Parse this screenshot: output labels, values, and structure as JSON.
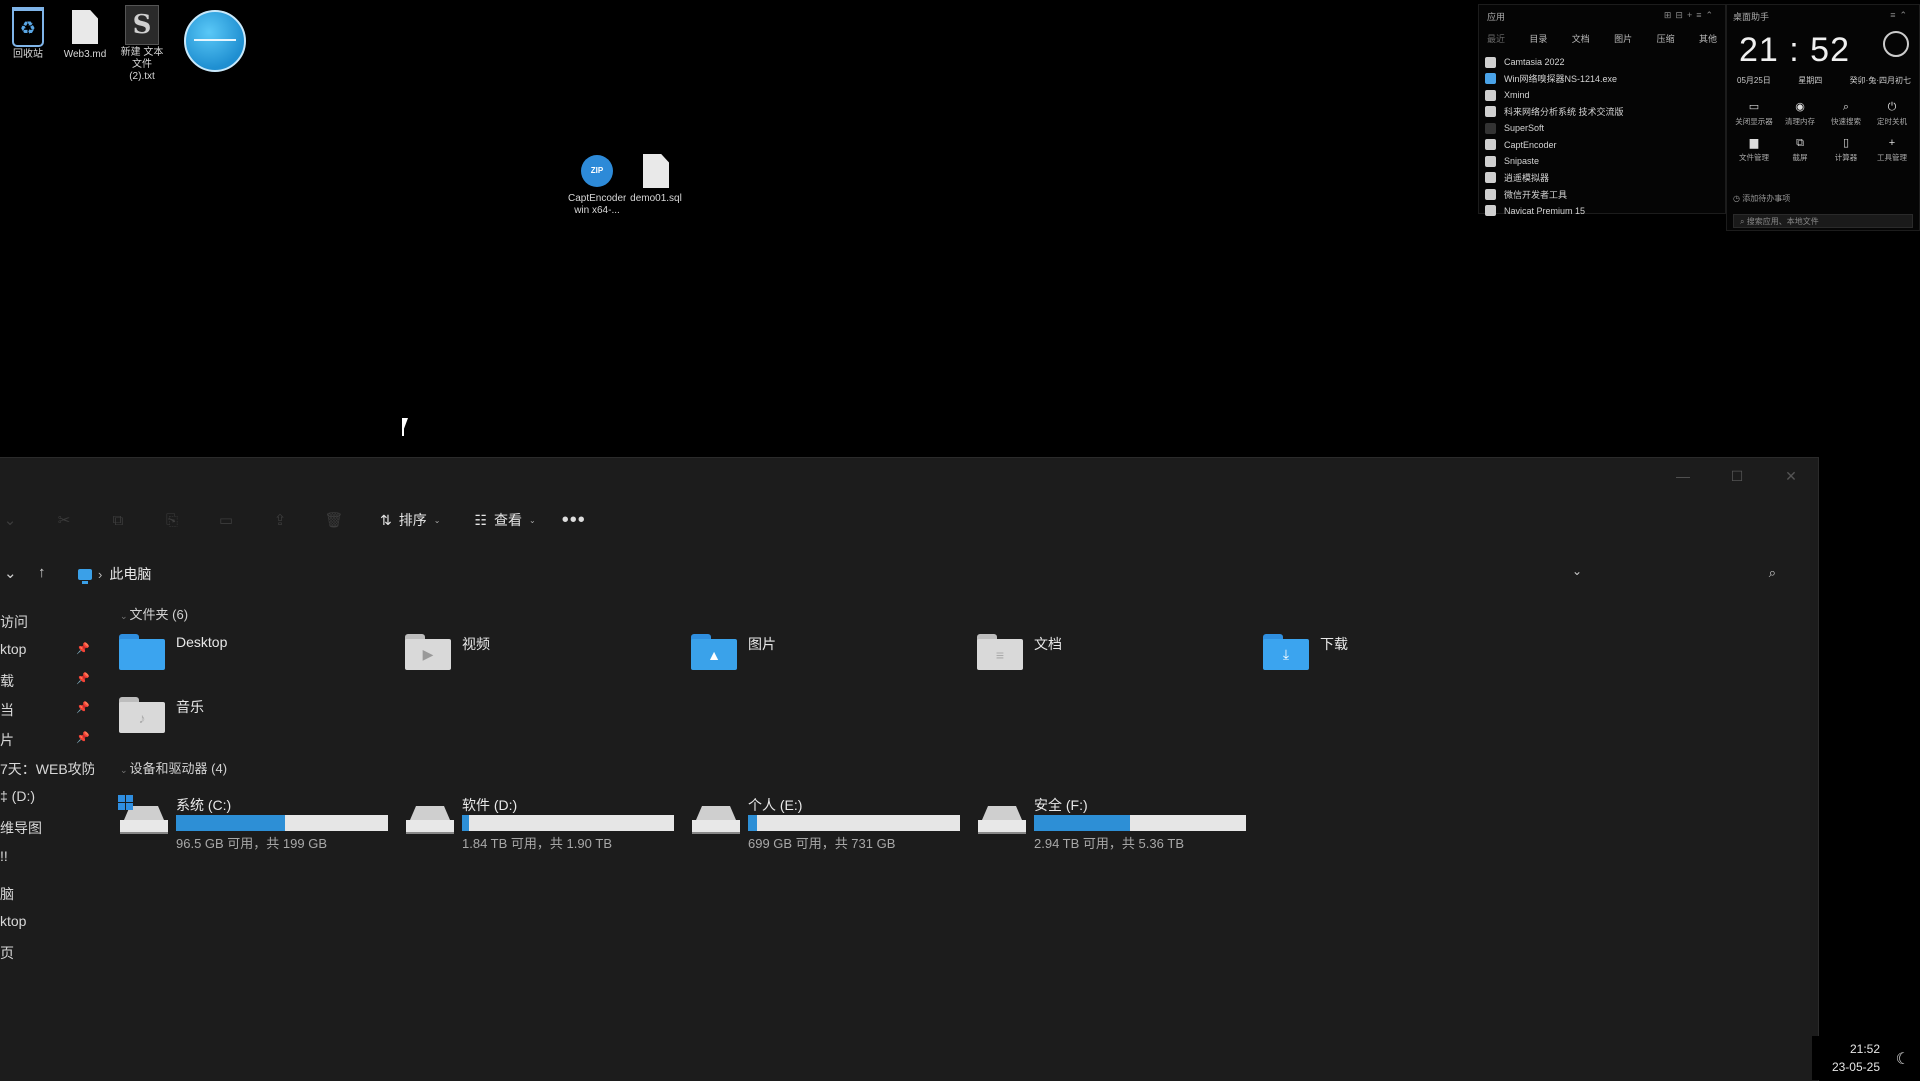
{
  "desktop": {
    "icons": [
      {
        "label": "回收站"
      },
      {
        "label": "Web3.md"
      },
      {
        "label": "新建 文本文件 (2).txt"
      }
    ],
    "middle_icons": [
      {
        "label": "CaptEncoder-win x64-..."
      },
      {
        "label": "demo01.sql"
      }
    ]
  },
  "apps_widget": {
    "title": "应用",
    "tabs": [
      "最近",
      "目录",
      "文档",
      "图片",
      "压缩",
      "其他"
    ],
    "apps": [
      "Camtasia 2022",
      "Win网络嗅探器NS-1214.exe",
      "Xmind",
      "科来网络分析系统 技术交流版",
      "SuperSoft",
      "CaptEncoder",
      "Snipaste",
      "逍遥模拟器",
      "微信开发者工具",
      "Navicat Premium 15"
    ]
  },
  "clock_widget": {
    "title": "桌面助手",
    "time": "21 : 52",
    "date": "05月25日",
    "weekday": "星期四",
    "lunar": "癸卯·兔·四月初七",
    "tools": [
      "关闭显示器",
      "清理内存",
      "快速搜索",
      "定时关机",
      "文件管理",
      "截屏",
      "计算器",
      "工具管理"
    ],
    "note": "添加待办事项",
    "search_placeholder": "搜索应用、本地文件"
  },
  "toolbar": {
    "sort": "排序",
    "view": "查看",
    "more": "•••"
  },
  "address": {
    "path": "此电脑"
  },
  "sidebar": {
    "items": [
      {
        "label": "访问"
      },
      {
        "label": "ktop"
      },
      {
        "label": "载"
      },
      {
        "label": "当"
      },
      {
        "label": "片"
      },
      {
        "label": "7天：WEB攻防"
      },
      {
        "label": "‡ (D:)"
      },
      {
        "label": "维导图"
      },
      {
        "label": "!!"
      },
      {
        "label": "脑"
      },
      {
        "label": "ktop"
      },
      {
        "label": "页"
      }
    ]
  },
  "content": {
    "folders_header": "文件夹 (6)",
    "folders": [
      {
        "label": "Desktop",
        "color": "#2f8fe0"
      },
      {
        "label": "视频",
        "color": "#d9d9d9"
      },
      {
        "label": "图片",
        "color": "#3aa2ea"
      },
      {
        "label": "文档",
        "color": "#d9d9d9"
      },
      {
        "label": "下载",
        "color": "#2f8fe0"
      },
      {
        "label": "音乐",
        "color": "#d9d9d9"
      }
    ],
    "drives_header": "设备和驱动器 (4)",
    "drives": [
      {
        "name": "系统 (C:)",
        "free": "96.5 GB 可用，共 199 GB",
        "used_fraction": 0.515
      },
      {
        "name": "软件 (D:)",
        "free": "1.84 TB 可用，共 1.90 TB",
        "used_fraction": 0.032
      },
      {
        "name": "个人 (E:)",
        "free": "699 GB 可用，共 731 GB",
        "used_fraction": 0.044
      },
      {
        "name": "安全 (F:)",
        "free": "2.94 TB 可用，共 5.36 TB",
        "used_fraction": 0.452
      }
    ]
  },
  "taskbar": {
    "time": "21:52",
    "date": "23-05-25"
  }
}
